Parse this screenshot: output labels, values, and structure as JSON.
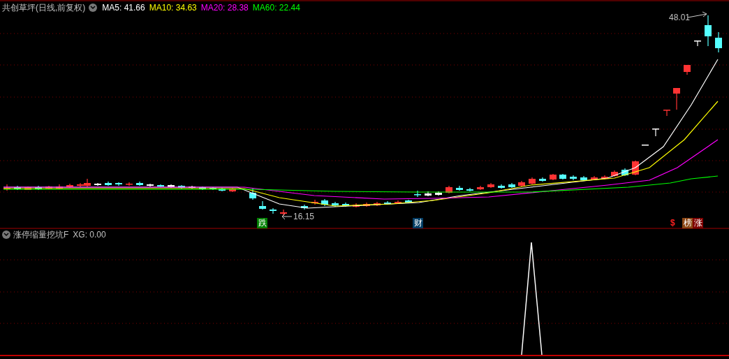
{
  "main_panel": {
    "title": "共创草坪(日线,前复权)",
    "ma_legend": [
      {
        "label": "MA5: 41.66",
        "color": "#ffffff"
      },
      {
        "label": "MA10: 34.63",
        "color": "#ffff00"
      },
      {
        "label": "MA20: 28.38",
        "color": "#ff00ff"
      },
      {
        "label": "MA60: 22.44",
        "color": "#00ff00"
      }
    ],
    "high_label": "48.01",
    "low_label": "16.15",
    "markers": [
      {
        "text": "跌",
        "kind": "badge",
        "color": "#008000"
      },
      {
        "text": "财",
        "kind": "badge",
        "color": "#003c64"
      },
      {
        "text": "$",
        "kind": "text",
        "color": "#ff2020"
      },
      {
        "text": "榜",
        "kind": "badge",
        "color": "#8b4513"
      },
      {
        "text": "涨",
        "kind": "badge",
        "color": "#800000"
      }
    ]
  },
  "indicator_panel": {
    "title": "涨停缩量挖坑F",
    "reading": "XG: 0.00"
  }
}
